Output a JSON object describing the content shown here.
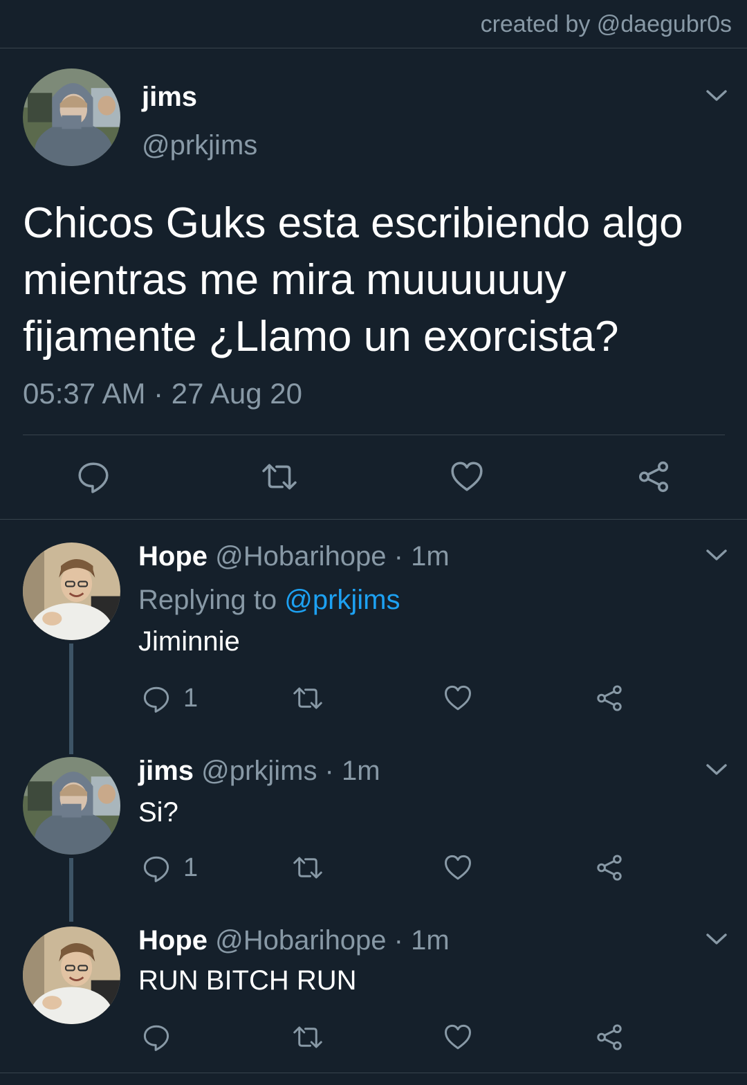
{
  "credit": "created by @daegubr0s",
  "main": {
    "name": "jims",
    "handle": "@prkjims",
    "text": "Chicos Guks esta escribiendo algo mientras me mira muuuuuuy fijamente ¿Llamo un exorcista?",
    "timestamp": "05:37 AM · 27 Aug 20"
  },
  "replies": [
    {
      "name": "Hope",
      "meta": "@Hobarihope · 1m",
      "replying_label": "Replying to ",
      "replying_handle": "@prkjims",
      "text": "Jiminnie",
      "reply_count": "1"
    },
    {
      "name": "jims",
      "meta": "@prkjims · 1m",
      "text": "Si?",
      "reply_count": "1"
    },
    {
      "name": "Hope",
      "meta": "@Hobarihope · 1m",
      "text": "RUN BITCH RUN",
      "reply_count": ""
    }
  ],
  "icons": {
    "reply": "reply-icon",
    "retweet": "retweet-icon",
    "like": "heart-icon",
    "share": "share-icon",
    "menu": "chevron-down-icon"
  },
  "colors": {
    "background": "#15202b",
    "muted": "#8899a6",
    "link": "#1da1f2",
    "divider": "#38444d"
  }
}
